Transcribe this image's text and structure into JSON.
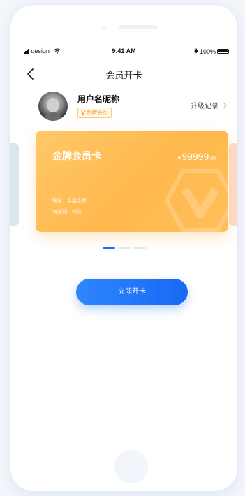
{
  "status_bar": {
    "carrier": "design",
    "time": "9:41 AM",
    "battery": "100%"
  },
  "nav": {
    "title": "会员开卡"
  },
  "user": {
    "nickname": "用户名昵称",
    "badge_label": "金牌会员",
    "upgrade_link": "升级记录"
  },
  "card": {
    "title": "金牌会员卡",
    "price_symbol": "¥",
    "price_main": "99999",
    "price_decimal": ".00",
    "level": "等级：金牌会员",
    "validity": "有效期：0天)"
  },
  "carousel": {
    "total": 3,
    "active_index": 0
  },
  "actions": {
    "open_card_label": "立即开卡"
  },
  "colors": {
    "accent_blue": "#1f6ef5",
    "card_gold": "#ffb84c",
    "badge_orange": "#f5a23a"
  }
}
